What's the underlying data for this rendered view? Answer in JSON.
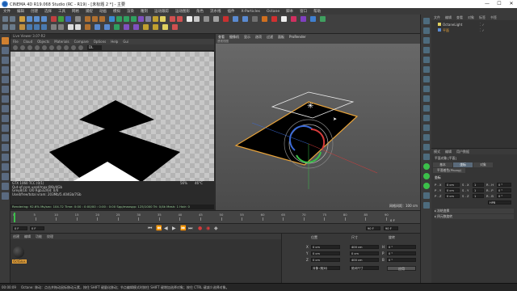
{
  "window": {
    "title": "CINEMA 4D R19.068 Studio (RC - R19) - [未标题 2 *] - 主要",
    "controls": {
      "minimize": "—",
      "maximize": "☐",
      "close": "✕"
    }
  },
  "menubar": {
    "items": [
      "文件",
      "编辑",
      "创建",
      "选择",
      "工具",
      "网格",
      "捕捉",
      "动画",
      "模拟",
      "渲染",
      "雕刻",
      "运动跟踪",
      "运动图形",
      "角色",
      "流水线",
      "插件",
      "X-Particles",
      "Octane",
      "脚本",
      "窗口",
      "帮助"
    ]
  },
  "live_viewer": {
    "title": "Live Viewer 3.07-R2",
    "menu": [
      "File",
      "Cloud",
      "Objects",
      "Materials",
      "Compare",
      "Options",
      "Help",
      "Gui"
    ],
    "mode_select": "DL",
    "status_lines": [
      "GTX 1060 TCC (0/1)",
      "Out-of-core used/max:0Kb/4Gb",
      "Grey8/16: 0/0    Rgb32/64: 0/0",
      "Used/free/total vram: 203Mb/5.404Gb/7Gb"
    ],
    "status_right_1": "56%",
    "status_right_2": "46°C",
    "progress_line": "Rendering: 92.6%   Ms/sec: 104.72   Time: 0:00 : 0:00/00 : 0:00 : 0:00   Spp/maxspp: 125/1000   Tri: 0/4k   Mesh: 1   Hair: 0"
  },
  "viewport": {
    "menu": [
      "查看",
      "摄像机",
      "显示",
      "选项",
      "过滤",
      "面板",
      "ProRender"
    ],
    "name": "透视视图",
    "grid_label": "网格间距：100 cm"
  },
  "object_manager": {
    "tabs": [
      "文件",
      "编辑",
      "查看",
      "对象",
      "标签",
      "书签"
    ],
    "objects": [
      {
        "name": "OctaneLight",
        "type": "light"
      },
      {
        "name": "平面",
        "type": "plane"
      }
    ]
  },
  "attribute_manager": {
    "tabs": [
      "模式",
      "编辑",
      "用户数据"
    ],
    "object_label": "平面对象 [平面]",
    "subtabs": [
      "基本",
      "坐标",
      "对象",
      "平滑着色(Phong)"
    ],
    "active_subtab": "坐标",
    "section_title": "坐标",
    "rows": [
      {
        "label": "P . X",
        "value": "0 cm",
        "label2": "S . X",
        "value2": "1",
        "label3": "R . H",
        "value3": "0 °"
      },
      {
        "label": "P . Y",
        "value": "0 cm",
        "label2": "S . Y",
        "value2": "1",
        "label3": "R . P",
        "value3": "0 °"
      },
      {
        "label": "P . Z",
        "value": "0 cm",
        "label2": "S . Z",
        "value2": "1",
        "label3": "R . B",
        "value3": "0 °"
      }
    ],
    "rotation_order": "HPB",
    "section2": "▸ 冻结变换",
    "section3": "▸ 四元数旋转"
  },
  "timeline": {
    "ticks": [
      "0",
      "5",
      "10",
      "15",
      "20",
      "25",
      "30",
      "35",
      "40",
      "45",
      "50",
      "55",
      "60",
      "65",
      "70",
      "75",
      "80",
      "85",
      "90"
    ],
    "frame_indicator": "0 F",
    "start": "0 F",
    "current": "0 F",
    "end": "90 F",
    "end2": "90 F"
  },
  "material_manager": {
    "menu": [
      "创建",
      "编辑",
      "功能",
      "纹理"
    ],
    "material_name": "OctGlos"
  },
  "coordinates": {
    "headers": [
      "位置",
      "尺寸",
      "旋转"
    ],
    "rows": [
      {
        "axis": "X",
        "pos": "0 cm",
        "size": "400 cm",
        "rot_label": "H",
        "rot": "0 °"
      },
      {
        "axis": "Y",
        "pos": "0 cm",
        "size": "0 cm",
        "rot_label": "P",
        "rot": "0 °"
      },
      {
        "axis": "Z",
        "pos": "0 cm",
        "size": "400 cm",
        "rot_label": "B",
        "rot": "0 °"
      }
    ],
    "mode": "对象 (相对)",
    "size_mode": "绝对尺寸",
    "apply": "应用"
  },
  "statusbar": {
    "left": "00:00:09",
    "text": "Octane: 移动：点击并拖动鼠标移动元素，按住 SHIFT 键量化移动；节点编辑模式时按住 SHIFT 键增加选择对象；按住 CTRL 键减少选择对象。"
  },
  "colors": {
    "accent_blue": "#1b5fb5",
    "selection_orange": "#e8a33a",
    "axis_red": "#d63b3b",
    "axis_green": "#3bbf4a",
    "axis_blue": "#3b6ad6"
  }
}
